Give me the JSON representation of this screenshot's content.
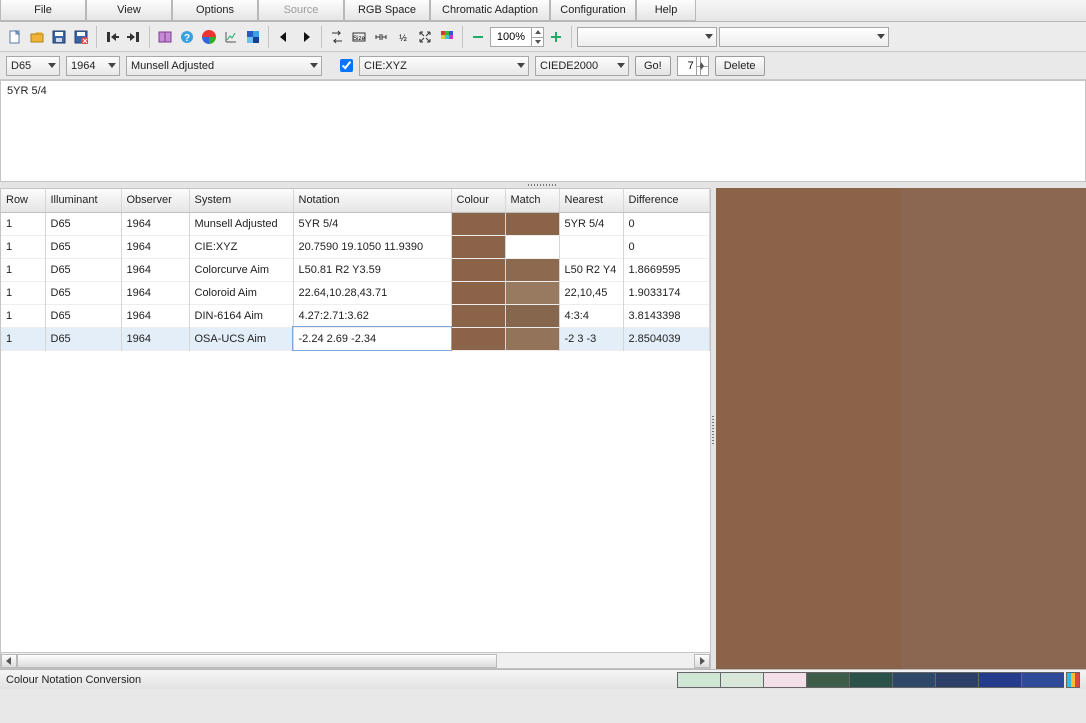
{
  "menu": {
    "items": [
      "File",
      "View",
      "Options",
      "Source",
      "RGB Space",
      "Chromatic Adaption",
      "Configuration",
      "Help"
    ],
    "disabled_index": 3
  },
  "toolbar": {
    "zoom": "100%"
  },
  "options": {
    "illuminant": "D65",
    "observer": "1964",
    "system": "Munsell Adjusted",
    "colourspace_checked": true,
    "colourspace": "CIE:XYZ",
    "delta_method": "CIEDE2000",
    "go_label": "Go!",
    "count_value": "7",
    "delete_label": "Delete"
  },
  "input_text": "5YR 5/4",
  "table": {
    "headers": [
      "Row",
      "Illuminant",
      "Observer",
      "System",
      "Notation",
      "Colour",
      "Match",
      "Nearest",
      "Difference"
    ],
    "rows": [
      {
        "row": "1",
        "illuminant": "D65",
        "observer": "1964",
        "system": "Munsell Adjusted",
        "notation": "5YR 5/4",
        "colour": "#8a6349",
        "match": "#8a6349",
        "nearest": "5YR 5/4",
        "difference": "0"
      },
      {
        "row": "1",
        "illuminant": "D65",
        "observer": "1964",
        "system": "CIE:XYZ",
        "notation": "20.7590 19.1050 11.9390",
        "colour": "#8a6349",
        "match": "#ffffff",
        "nearest": "",
        "difference": "0"
      },
      {
        "row": "1",
        "illuminant": "D65",
        "observer": "1964",
        "system": "Colorcurve Aim",
        "notation": "L50.81 R2 Y3.59",
        "colour": "#8a6349",
        "match": "#8d6a4f",
        "nearest": "L50 R2 Y4",
        "difference": "1.8669595"
      },
      {
        "row": "1",
        "illuminant": "D65",
        "observer": "1964",
        "system": "Coloroid Aim",
        "notation": "22.64,10.28,43.71",
        "colour": "#8a6349",
        "match": "#987a61",
        "nearest": "22,10,45",
        "difference": "1.9033174"
      },
      {
        "row": "1",
        "illuminant": "D65",
        "observer": "1964",
        "system": "DIN-6164 Aim",
        "notation": "4.27:2.71:3.62",
        "colour": "#8a6349",
        "match": "#86664d",
        "nearest": "4:3:4",
        "difference": "3.8143398"
      },
      {
        "row": "1",
        "illuminant": "D65",
        "observer": "1964",
        "system": "OSA-UCS Aim",
        "notation": "-2.24 2.69 -2.34",
        "colour": "#8a6349",
        "match": "#93745a",
        "nearest": "-2 3 -3",
        "difference": "2.8504039"
      }
    ],
    "selected_index": 5
  },
  "preview": {
    "left_color": "#8a6349",
    "right_color": "#8b6651"
  },
  "status": {
    "text": "Colour Notation Conversion",
    "swatches": [
      "#d0e6d4",
      "#d7e8db",
      "#f3dfe7",
      "#3e5d4a",
      "#2a5249",
      "#2d4967",
      "#2c3f67",
      "#243a8a",
      "#2e4a98"
    ]
  }
}
